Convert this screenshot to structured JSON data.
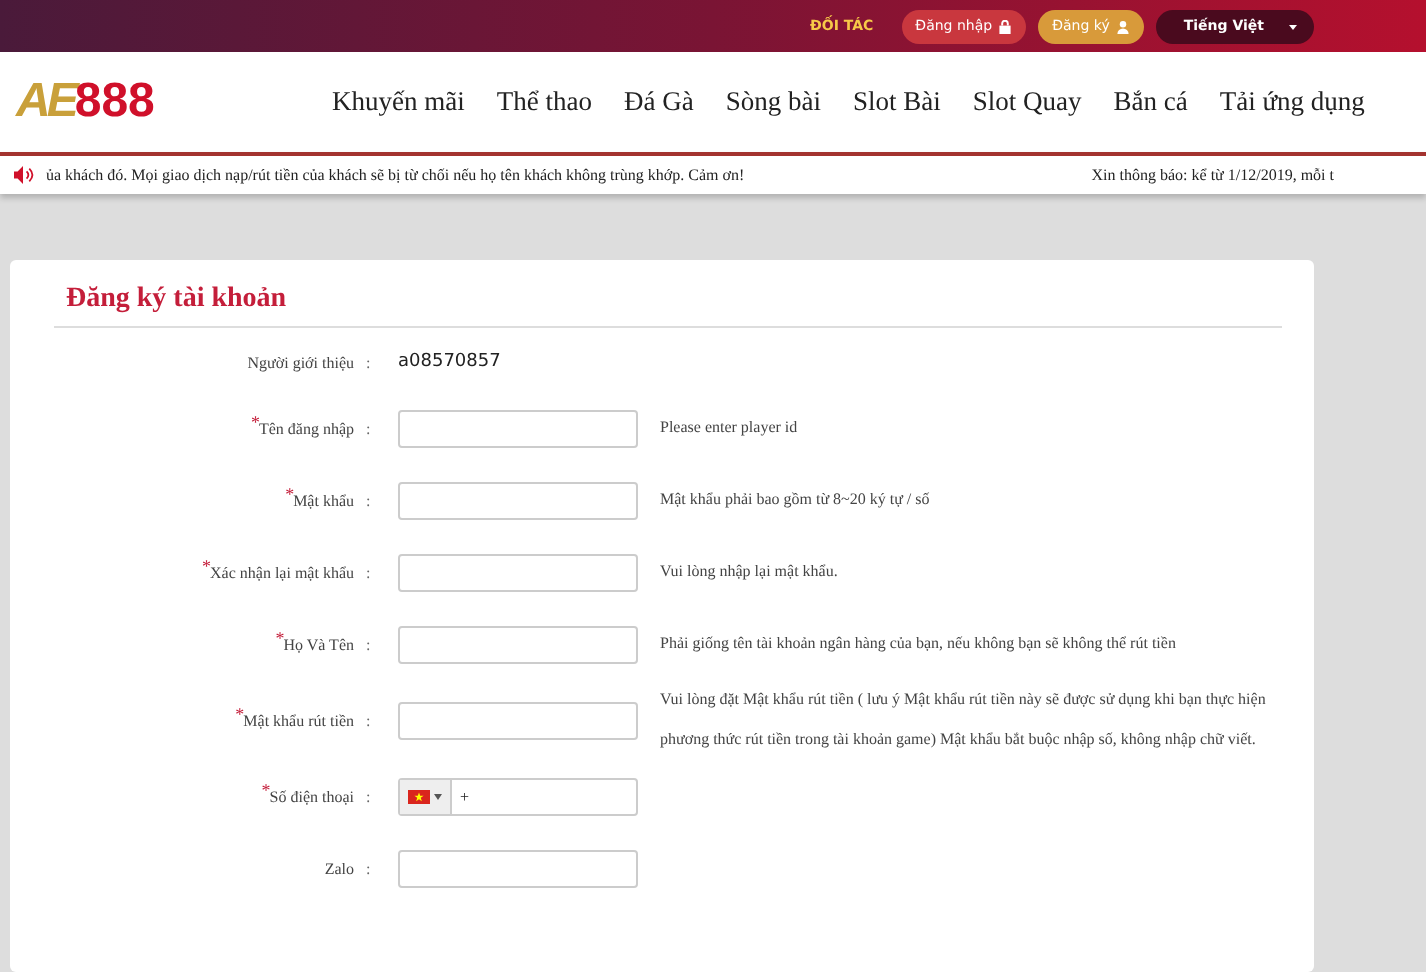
{
  "top_bar": {
    "partner_link": "ĐỐI TÁC",
    "login_button": "Đăng nhập",
    "register_button": "Đăng ký",
    "language": "Tiếng Việt"
  },
  "header": {
    "logo": {
      "letters": "AE",
      "number": "888"
    },
    "nav": [
      "Khuyến mãi",
      "Thể thao",
      "Đá Gà",
      "Sòng bài",
      "Slot Bài",
      "Slot Quay",
      "Bắn cá",
      "Tải ứng dụng"
    ]
  },
  "notice_bar": {
    "marquee": "ủa khách đó. Mọi giao dịch nạp/rút tiền của khách sẽ bị từ chối nếu họ tên khách không trùng khớp. Cảm ơn!",
    "announcement": "Xin thông báo: kể từ 1/12/2019, mỗi t"
  },
  "form": {
    "title": "Đăng ký tài khoản",
    "fields": [
      {
        "kind": "static",
        "label": "Người giới thiệu",
        "colon": ":",
        "value": "a08570857"
      },
      {
        "kind": "text",
        "required_mark": "*",
        "label": "Tên đăng nhập",
        "colon": ":",
        "hint": "Please enter player id"
      },
      {
        "kind": "text",
        "required_mark": "*",
        "label": "Mật khẩu",
        "colon": ":",
        "hint": "Mật khẩu phải bao gồm từ 8~20 ký tự / số"
      },
      {
        "kind": "text",
        "required_mark": "*",
        "label": "Xác nhận lại mật khẩu",
        "colon": ":",
        "hint": "Vui lòng nhập lại mật khẩu."
      },
      {
        "kind": "text",
        "required_mark": "*",
        "label": "Họ Và Tên",
        "colon": ":",
        "hint": "Phải giống tên tài khoản ngân hàng của bạn, nếu không bạn sẽ không thể rút tiền"
      },
      {
        "kind": "text",
        "required_mark": "*",
        "label": "Mật khẩu rút tiền",
        "colon": ":",
        "hint": "Vui lòng đặt Mật khẩu rút tiền ( lưu ý Mật khẩu rút tiền này sẽ được sử dụng khi bạn thực hiện phương thức rút tiền trong tài khoản game) Mật khẩu bắt buộc nhập số, không nhập chữ viết."
      },
      {
        "kind": "phone",
        "required_mark": "*",
        "label": "Số điện thoại",
        "colon": ":",
        "value": "+"
      },
      {
        "kind": "text",
        "label": "Zalo",
        "colon": ":"
      }
    ]
  }
}
